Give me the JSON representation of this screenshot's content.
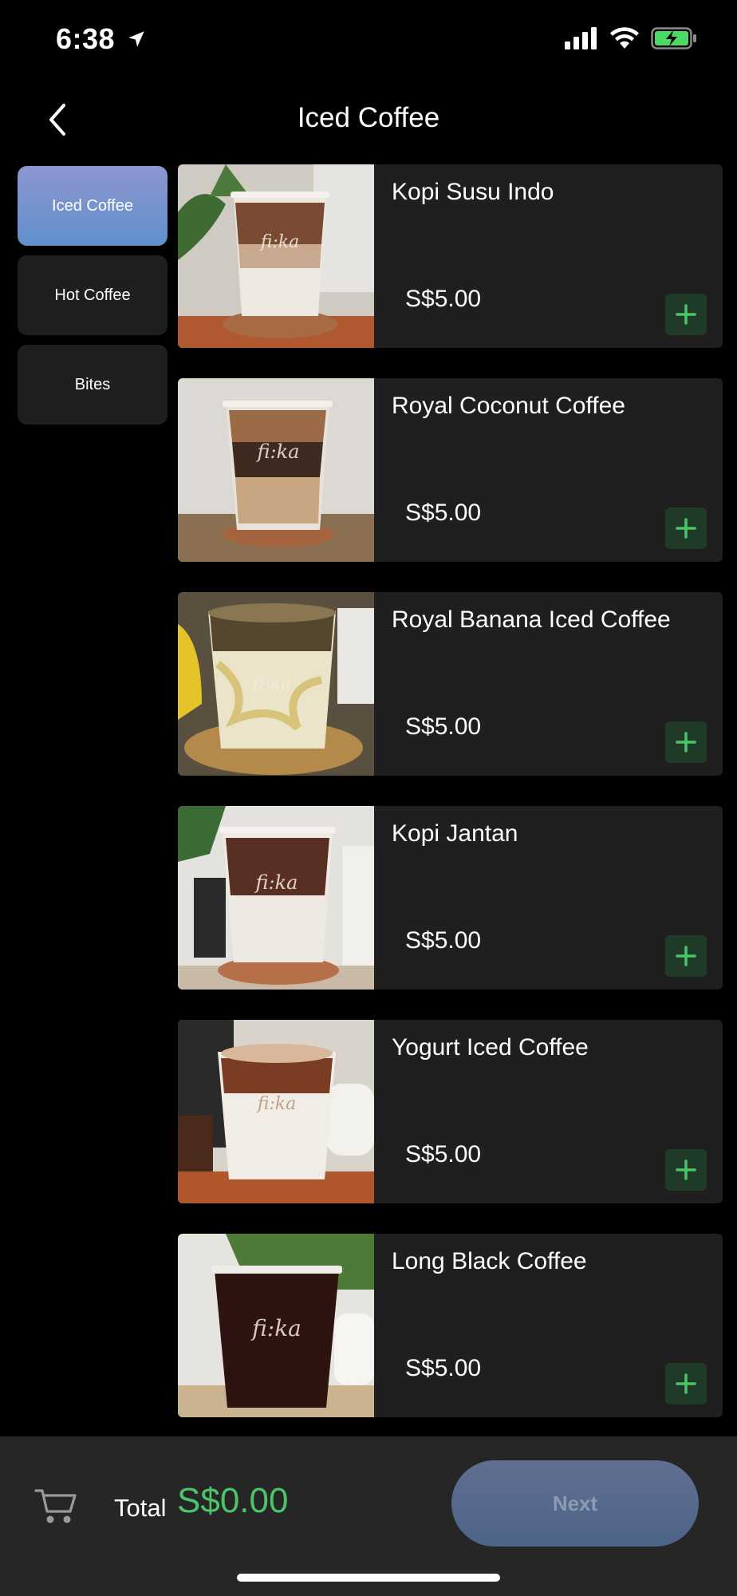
{
  "status_bar": {
    "time": "6:38"
  },
  "header": {
    "title": "Iced Coffee"
  },
  "sidebar": {
    "categories": [
      {
        "label": "Iced Coffee",
        "active": true
      },
      {
        "label": "Hot Coffee",
        "active": false
      },
      {
        "label": "Bites",
        "active": false
      }
    ]
  },
  "products": [
    {
      "name": "Kopi Susu Indo",
      "price": "S$5.00"
    },
    {
      "name": "Royal Coconut Coffee",
      "price": "S$5.00"
    },
    {
      "name": "Royal Banana Iced Coffee",
      "price": "S$5.00"
    },
    {
      "name": "Kopi Jantan",
      "price": "S$5.00"
    },
    {
      "name": "Yogurt Iced Coffee",
      "price": "S$5.00"
    },
    {
      "name": "Long Black Coffee",
      "price": "S$5.00"
    }
  ],
  "product_image_brand": "fi:ka",
  "bottom_bar": {
    "total_label": "Total",
    "total_value": "S$0.00",
    "next_label": "Next"
  },
  "colors": {
    "accent_green": "#4cc56a",
    "active_category": "#6f93cf",
    "next_button": "#566a8d"
  }
}
